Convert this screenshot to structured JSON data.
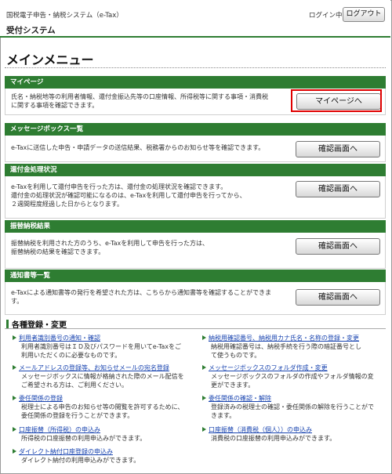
{
  "header": {
    "system_name": "国税電子申告・納税システム（e-Tax）",
    "subsystem": "受付システム",
    "login_status": "ログイン中",
    "logout_label": "ログアウト"
  },
  "main_title": "メインメニュー",
  "sections": [
    {
      "title": "マイページ",
      "text": [
        "氏名・納税地等の利用者情報、還付金振込先等の口座情報、所得税等に関する事項・消費税",
        "に関する事項を確認できます。"
      ],
      "button": "マイページへ"
    },
    {
      "title": "メッセージボックス一覧",
      "text": [
        "e-Taxに送信した申告・申請データの送信結果、税務署からのお知らせ等を確認できます。"
      ],
      "button": "確認画面へ"
    },
    {
      "title": "還付金処理状況",
      "text": [
        "e-Taxを利用して還付申告を行った方は、還付金の処理状況を確認できます。",
        "還付金の処理状況が確認可能になるのは、e-Taxを利用して還付申告を行ってから、",
        "２週間程度経過した日からとなります。"
      ],
      "button": "確認画面へ"
    },
    {
      "title": "振替納税結果",
      "text": [
        "振替納税を利用された方のうち、e-Taxを利用して申告を行った方は、",
        "振替納税の結果を確認できます。"
      ],
      "button": "確認画面へ"
    },
    {
      "title": "通知書等一覧",
      "text": [
        "e-Taxによる通知書等の発行を希望された方は、こちらから通知書等を確認することができま",
        "す。"
      ],
      "button": "確認画面へ"
    }
  ],
  "registration": {
    "title": "各種登録・変更",
    "left": [
      {
        "link": "利用者識別番号の通知・確認",
        "desc": [
          "利用者識別番号はＩＤ及びパスワードを用いてe-Taxをご",
          "利用いただくのに必要なものです。"
        ]
      },
      {
        "link": "メールアドレスの登録等、お知らせメールの宛名登録",
        "desc": [
          "メッセージボックスに情報が格納された際のメール配信を",
          "ご希望される方は、ご利用ください。"
        ]
      },
      {
        "link": "委任関係の登録",
        "desc": [
          "税理士による申告のお知らせ等の閲覧を許可するために、",
          "委任関係の登録を行うことができます。"
        ]
      },
      {
        "link": "口座振替（所得税）の申込み",
        "desc": [
          "所得税の口座振替の利用申込みができます。"
        ]
      },
      {
        "link": "ダイレクト納付口座登録の申込み",
        "desc": [
          "ダイレクト納付の利用申込みができます。"
        ]
      }
    ],
    "right": [
      {
        "link": "納税用確認番号、納税用カナ氏名・名称の登録・変更",
        "desc": [
          "納税用確認番号は、納税手続を行う際の暗証番号とし",
          "て使うものです。"
        ]
      },
      {
        "link": "メッセージボックスのフォルダ作成・変更",
        "desc": [
          "メッセージボックスのフォルダの作成やフォルダ情報の変",
          "更ができます。"
        ]
      },
      {
        "link": "委任関係の確認・解除",
        "desc": [
          "登録済みの税理士の確認・委任関係の解除を行うことがで",
          "きます。"
        ]
      },
      {
        "link": "口座振替（消費税（個人））の申込み",
        "desc": [
          "消費税の口座振替の利用申込みができます。"
        ]
      }
    ]
  },
  "colors": {
    "accent": "#2e7d32",
    "link": "#1a45b0",
    "highlight": "#e00000"
  }
}
